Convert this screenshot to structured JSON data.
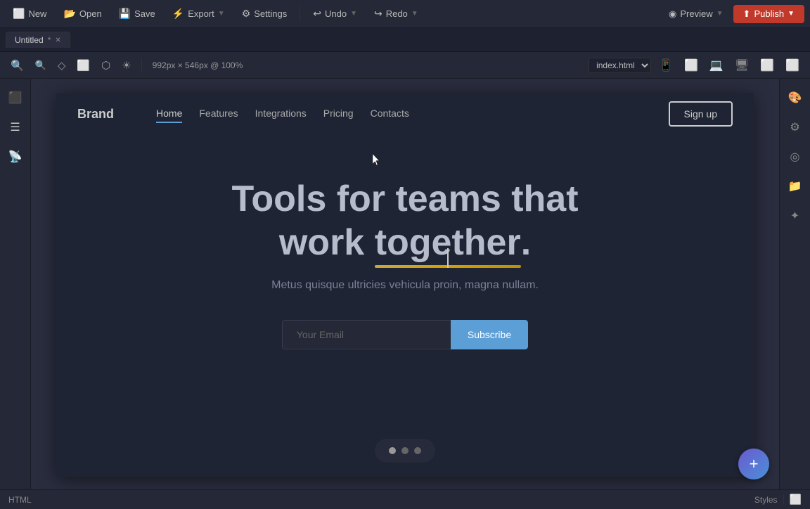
{
  "toolbar": {
    "new_label": "New",
    "open_label": "Open",
    "save_label": "Save",
    "export_label": "Export",
    "settings_label": "Settings",
    "undo_label": "Undo",
    "redo_label": "Redo",
    "preview_label": "Preview",
    "publish_label": "Publish"
  },
  "tab": {
    "name": "Untitled",
    "modified": "*"
  },
  "canvas_toolbar": {
    "dimensions": "992px × 546px @ 100%",
    "page": "index.html"
  },
  "sidebar": {
    "tools": [
      "⊞",
      "☰",
      "≡",
      "◎",
      "⚙"
    ]
  },
  "preview": {
    "nav": {
      "brand": "Brand",
      "links": [
        "Home",
        "Features",
        "Integrations",
        "Pricing",
        "Contacts"
      ],
      "active_link": "Home",
      "signup": "Sign up"
    },
    "hero": {
      "title_part1": "Tools for teams that",
      "title_part2": "work ",
      "title_highlight": "together",
      "title_punctuation": ".",
      "subtitle": "Metus quisque ultricies vehicula proin, magna nullam.",
      "email_placeholder": "Your Email",
      "subscribe_label": "Subscribe"
    },
    "dots": [
      "●",
      "●",
      "●"
    ]
  },
  "status_bar": {
    "left": "HTML",
    "right": "Styles"
  }
}
